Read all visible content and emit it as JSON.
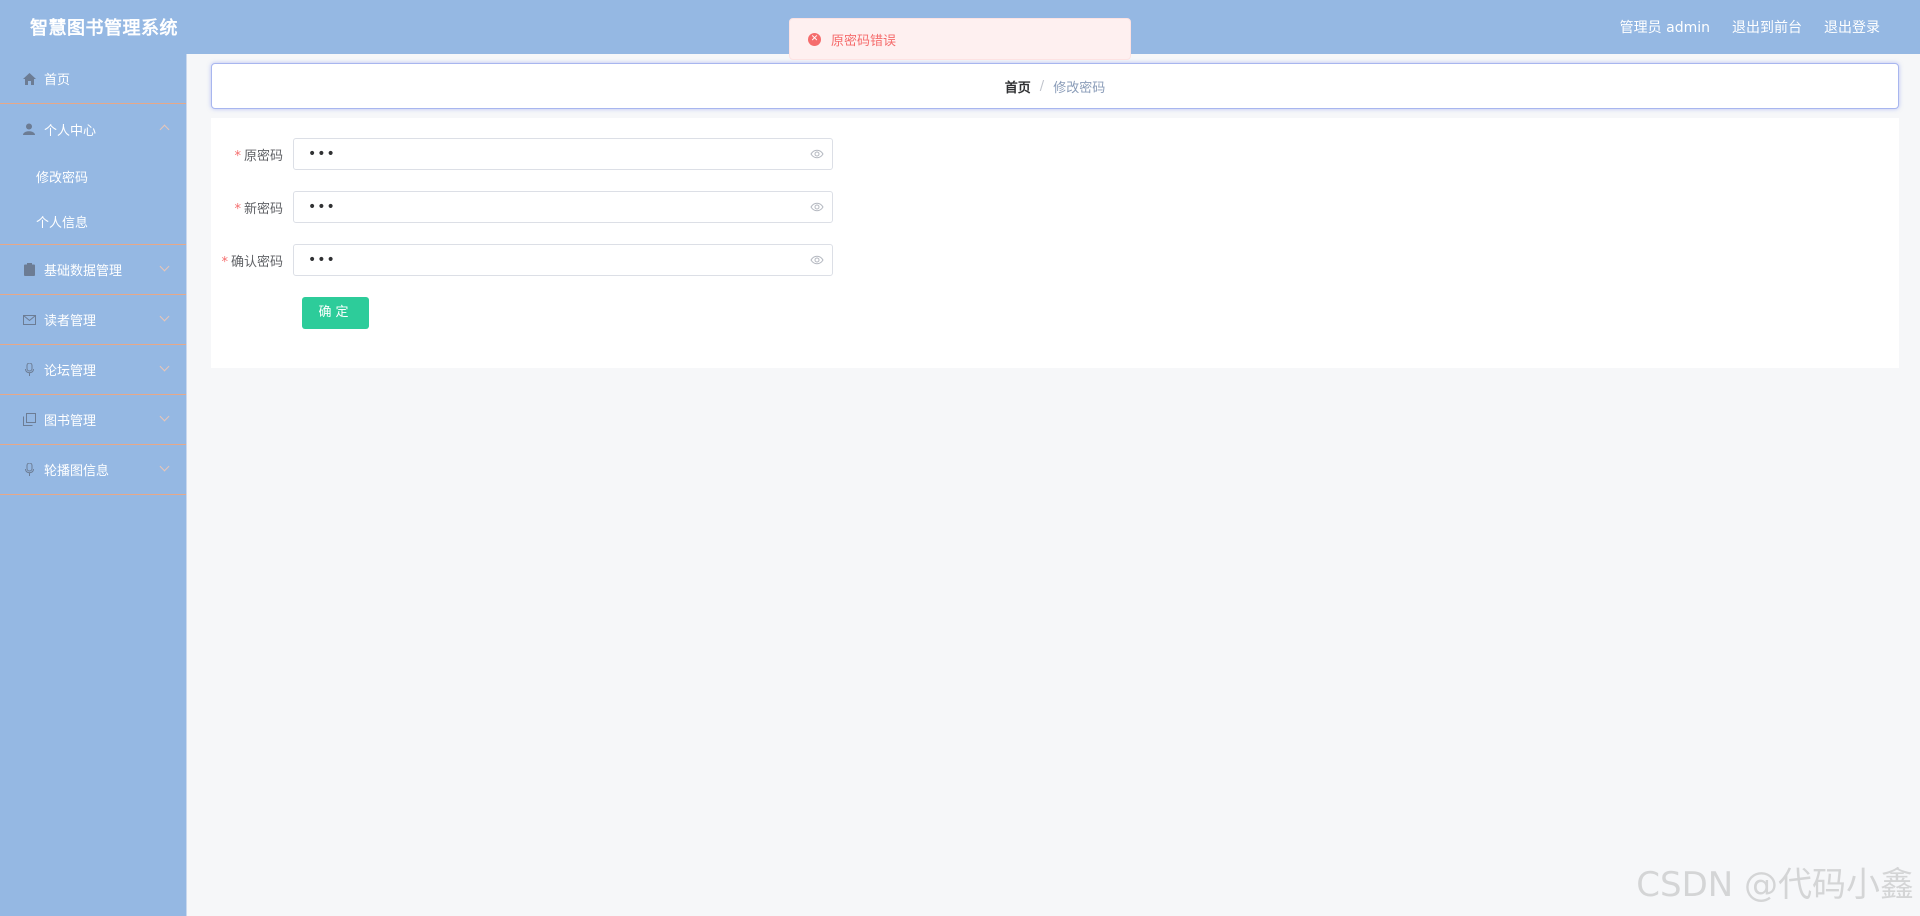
{
  "header": {
    "title": "智慧图书管理系统",
    "admin_label": "管理员 admin",
    "to_front": "退出到前台",
    "logout": "退出登录"
  },
  "toast": {
    "message": "原密码错误",
    "type": "error"
  },
  "sidebar": {
    "items": [
      {
        "label": "首页",
        "icon": "home-icon"
      },
      {
        "label": "个人中心",
        "icon": "user-icon",
        "expanded": true,
        "children": [
          {
            "label": "修改密码"
          },
          {
            "label": "个人信息"
          }
        ]
      },
      {
        "label": "基础数据管理",
        "icon": "clipboard-icon"
      },
      {
        "label": "读者管理",
        "icon": "mail-icon"
      },
      {
        "label": "论坛管理",
        "icon": "microphone-icon"
      },
      {
        "label": "图书管理",
        "icon": "copy-icon"
      },
      {
        "label": "轮播图信息",
        "icon": "microphone-icon"
      }
    ]
  },
  "breadcrumb": {
    "home": "首页",
    "separator": "/",
    "current": "修改密码"
  },
  "form": {
    "old_password": {
      "label": "原密码",
      "value": "•••"
    },
    "new_password": {
      "label": "新密码",
      "value": "•••"
    },
    "confirm_password": {
      "label": "确认密码",
      "value": "•••"
    },
    "required_mark": "*",
    "submit_label": "确定"
  },
  "watermark": "CSDN @代码小鑫",
  "colors": {
    "header_bg": "#95b8e3",
    "sidebar_bg": "#95b8e3",
    "submit_bg": "#2dcc9a",
    "error": "#f56c6c"
  }
}
